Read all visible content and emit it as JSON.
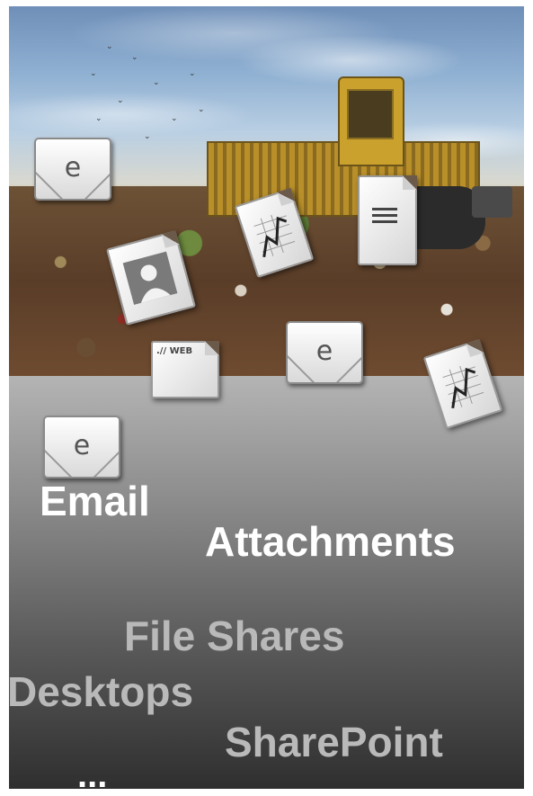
{
  "labels": {
    "email": "Email",
    "attachments": "Attachments",
    "file_shares": "File Shares",
    "desktops": "Desktops",
    "sharepoint": "SharePoint",
    "ellipsis": "..."
  },
  "icons": {
    "envelope_letter": "e",
    "web_doc_label": ".// WEB",
    "envelope": "envelope-icon",
    "text_doc": "text-document-icon",
    "chart_doc": "chart-document-icon",
    "contact_doc": "contact-document-icon",
    "web_doc": "web-document-icon"
  },
  "colors": {
    "primary_text": "#ffffff",
    "secondary_text": "#b9b9b9",
    "gradient_top": "#b4b4b4",
    "gradient_bottom": "#2f2f2f"
  }
}
